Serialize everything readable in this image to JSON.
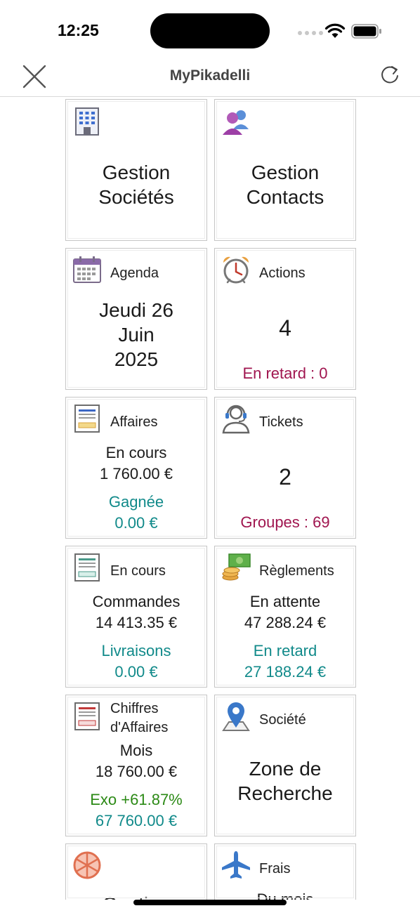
{
  "status": {
    "time": "12:25"
  },
  "nav": {
    "title": "MyPikadelli"
  },
  "tiles": {
    "societes": {
      "line1": "Gestion",
      "line2": "Sociétés"
    },
    "contacts": {
      "line1": "Gestion",
      "line2": "Contacts"
    },
    "agenda": {
      "label": "Agenda",
      "day": "Jeudi 26",
      "month": "Juin",
      "year": "2025"
    },
    "actions": {
      "label": "Actions",
      "count": "4",
      "late": "En retard : 0"
    },
    "affaires": {
      "label": "Affaires",
      "status": "En cours",
      "amount": "1 760.00 €",
      "won_label": "Gagnée",
      "won_amount": "0.00 €"
    },
    "tickets": {
      "label": "Tickets",
      "count": "2",
      "groups": "Groupes : 69"
    },
    "commandes": {
      "label": "En cours",
      "title": "Commandes",
      "amount": "14 413.35 €",
      "deliveries_label": "Livraisons",
      "deliveries_amount": "0.00 €"
    },
    "reglements": {
      "label": "Règlements",
      "status": "En attente",
      "amount": "47 288.24 €",
      "late_label": "En retard",
      "late_amount": "27 188.24 €"
    },
    "chiffres": {
      "label_line1": "Chiffres",
      "label_line2": "d'Affaires",
      "period": "Mois",
      "amount": "18 760.00 €",
      "exo": "Exo +61.87%",
      "exo_amount": "67 760.00 €"
    },
    "societe_search": {
      "label": "Société",
      "line1": "Zone de",
      "line2": "Recherche"
    },
    "gestion": {
      "line1": "Gestion"
    },
    "frais": {
      "label": "Frais",
      "period": "Du mois"
    }
  },
  "colors": {
    "teal": "#118a8a",
    "crimson": "#a0154f",
    "green": "#2c8a16"
  }
}
